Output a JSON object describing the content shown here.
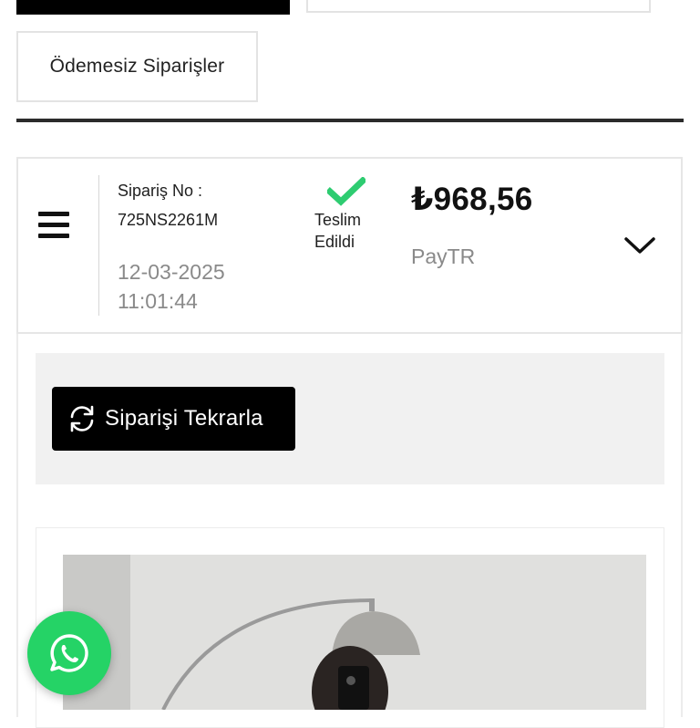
{
  "tabs": {
    "unpaid_orders": "Ödemesiz Siparişler"
  },
  "order": {
    "number_label": "Sipariş No :",
    "number": "725NS2261M",
    "date": "12-03-2025",
    "time": "11:01:44",
    "status_line1": "Teslim",
    "status_line2": "Edildi",
    "status_color": "#2ecc71",
    "price": "₺968,56",
    "payment_method": "PayTR"
  },
  "actions": {
    "reorder_label": "Siparişi Tekrarla"
  },
  "icons": {
    "menu": "hamburger-menu-icon",
    "status": "checkmark-icon",
    "expand": "chevron-down-icon",
    "reorder": "refresh-icon",
    "chat": "whatsapp-icon"
  },
  "colors": {
    "accent_dark": "#000000",
    "whatsapp": "#25d366",
    "muted_text": "#8a8a8a"
  }
}
